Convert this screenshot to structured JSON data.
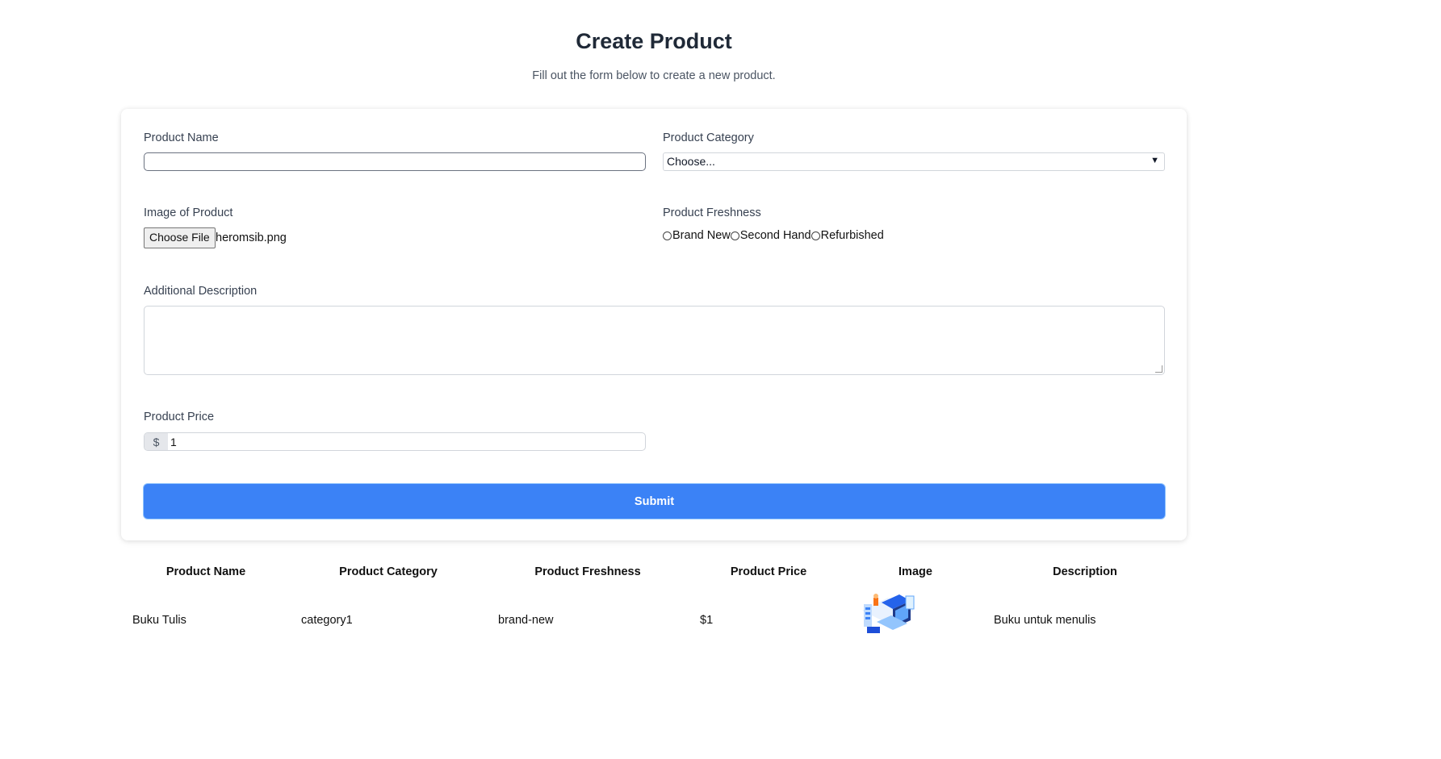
{
  "header": {
    "title": "Create Product",
    "subtitle": "Fill out the form below to create a new product."
  },
  "form": {
    "product_name": {
      "label": "Product Name",
      "value": ""
    },
    "product_category": {
      "label": "Product Category",
      "selected": "Choose..."
    },
    "image": {
      "label": "Image of Product",
      "button_label": "Choose File",
      "file_name": "heromsib.png"
    },
    "freshness": {
      "label": "Product Freshness",
      "options": [
        "Brand New",
        "Second Hand",
        "Refurbished"
      ]
    },
    "description": {
      "label": "Additional Description",
      "value": ""
    },
    "price": {
      "label": "Product Price",
      "prefix": "$",
      "value": "1"
    },
    "submit_label": "Submit"
  },
  "table": {
    "headers": [
      "Product Name",
      "Product Category",
      "Product Freshness",
      "Product Price",
      "Image",
      "Description"
    ],
    "rows": [
      {
        "name": "Buku Tulis",
        "category": "category1",
        "freshness": "brand-new",
        "price": "$1",
        "image": "product-thumbnail",
        "description": "Buku untuk menulis"
      }
    ]
  },
  "colors": {
    "accent": "#3b82f6",
    "title": "#1f2937"
  }
}
